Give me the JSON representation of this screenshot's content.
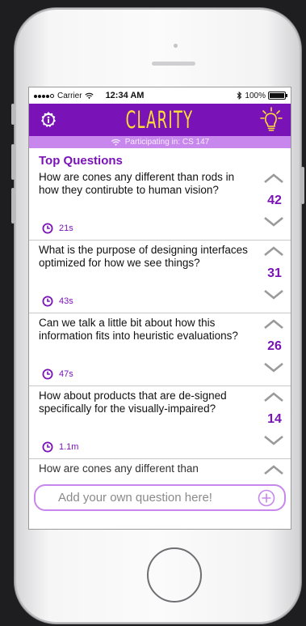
{
  "status_bar": {
    "carrier": "Carrier",
    "time": "12:34 AM",
    "battery": "100%"
  },
  "app_bar": {
    "title": "CLARITY",
    "background_color": "#7a13b7",
    "title_color": "#ffdd33",
    "left_icon": "info-icon",
    "right_icon": "lightbulb-icon"
  },
  "session": {
    "text": "Participating in: CS 147",
    "icon": "wifi-icon",
    "background_color": "#c787ec"
  },
  "questions_heading": "Top Questions",
  "questions": [
    {
      "text": "How are cones any different than rods in how they contirubte to human vision?",
      "votes": "42",
      "time": "21s"
    },
    {
      "text": "What is the purpose of designing interfaces optimized for how we see things?",
      "votes": "31",
      "time": "43s"
    },
    {
      "text": "Can we talk a little bit about how this information fits into heuristic evaluations?",
      "votes": "26",
      "time": "47s"
    },
    {
      "text": "How about products that are de-signed specifically for the visually-impaired?",
      "votes": "14",
      "time": "1.1m"
    },
    {
      "text": "How are cones any different than"
    }
  ],
  "add_question": {
    "placeholder": "Add your own question here!",
    "button_icon": "plus-circle-icon"
  }
}
